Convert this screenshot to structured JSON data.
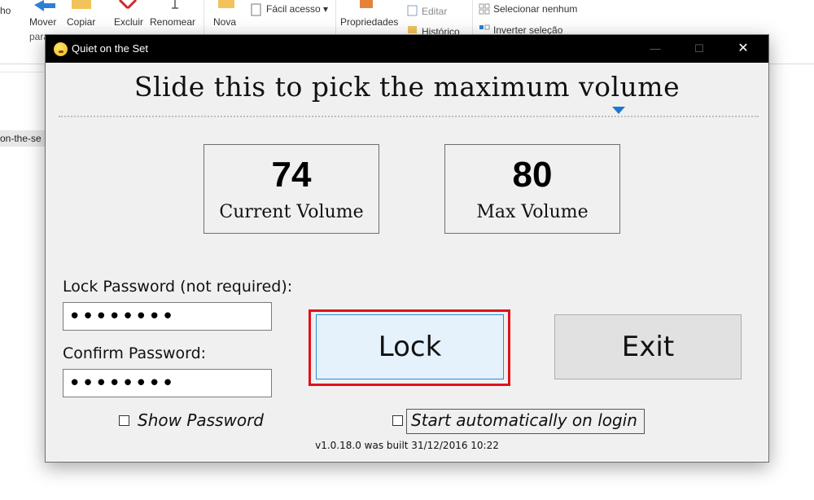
{
  "explorer": {
    "ribbon": {
      "truncated_left": "ho",
      "move": "Mover",
      "move_sub": "para",
      "copy": "Copiar",
      "delete": "Excluir",
      "rename": "Renomear",
      "new": "Nova",
      "easy_access": "Fácil acesso",
      "properties": "Propriedades",
      "edit": "Editar",
      "history": "Histórico",
      "select_none": "Selecionar nenhum",
      "invert_selection": "Inverter seleção"
    },
    "nav_item": "on-the-se"
  },
  "window": {
    "title": "Quiet on the Set",
    "minimize": "—",
    "maximize": "☐",
    "close": "✕"
  },
  "heading": "Slide this to pick the maximum volume",
  "slider": {
    "value_fraction": 0.8
  },
  "current_volume": {
    "value": "74",
    "label": "Current Volume"
  },
  "max_volume": {
    "value": "80",
    "label": "Max Volume"
  },
  "lock_password": {
    "label": "Lock Password (not required):",
    "value": "••••••••"
  },
  "confirm_password": {
    "label": "Confirm Password:",
    "value": "••••••••"
  },
  "buttons": {
    "lock": "Lock",
    "exit": "Exit"
  },
  "show_password": {
    "label": "Show Password",
    "checked": false
  },
  "start_auto": {
    "label": "Start automatically on login",
    "checked": false
  },
  "version": "v1.0.18.0 was built 31/12/2016 10:22",
  "colors": {
    "accent": "#1e78d2",
    "highlight": "#e0101b",
    "titlebar": "#000000"
  }
}
